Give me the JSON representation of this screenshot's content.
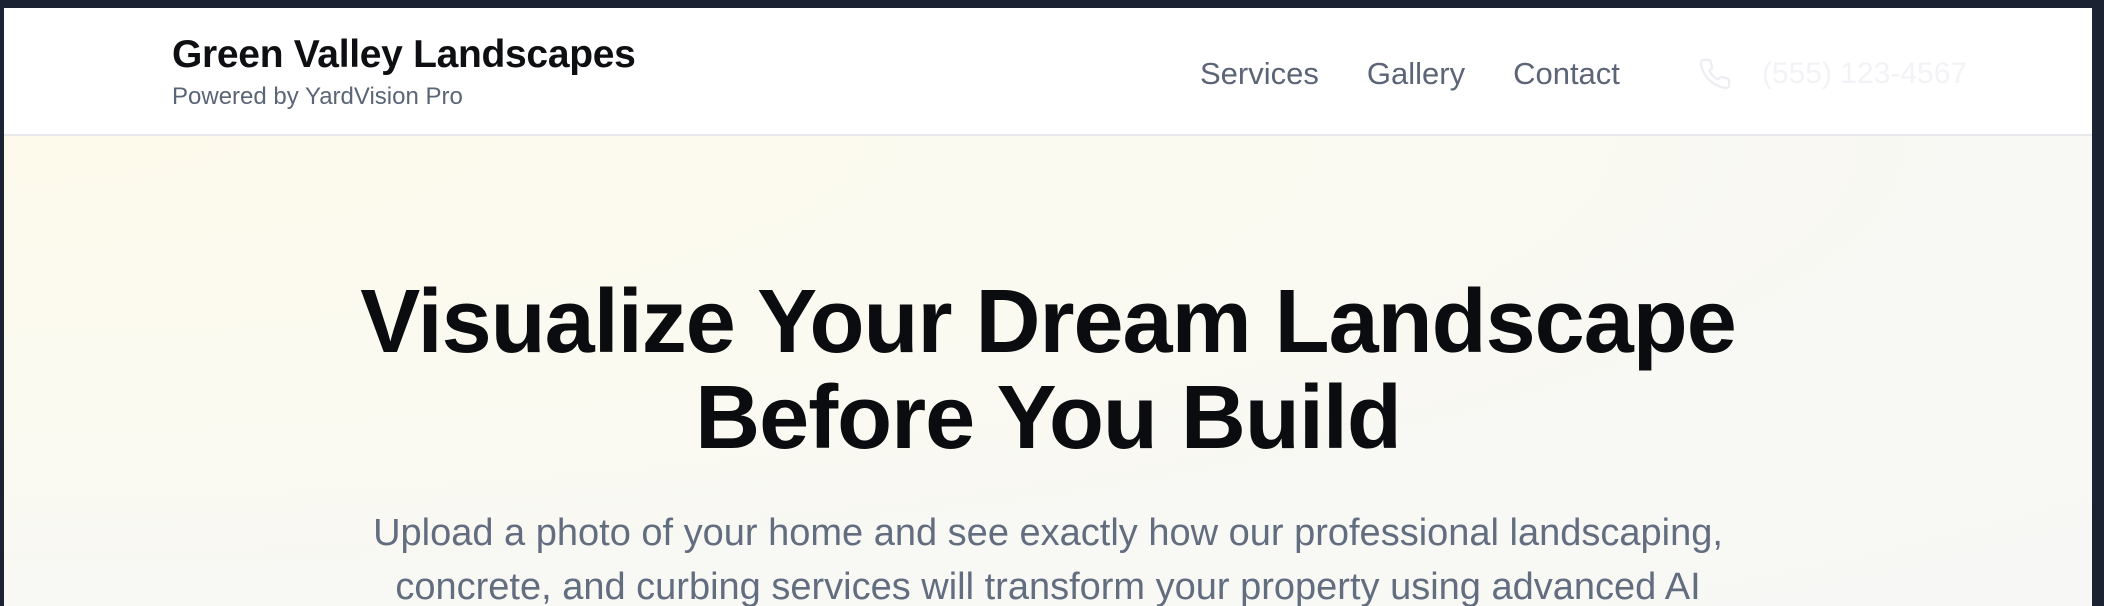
{
  "header": {
    "brand_name": "Green Valley Landscapes",
    "brand_tagline": "Powered by YardVision Pro",
    "nav": [
      {
        "label": "Services"
      },
      {
        "label": "Gallery"
      },
      {
        "label": "Contact"
      }
    ],
    "phone": {
      "icon": "phone-icon",
      "number": "(555) 123-4567"
    }
  },
  "hero": {
    "title_line1": "Visualize Your Dream Landscape",
    "title_line2": "Before You Build",
    "subtitle_line1": "Upload a photo of your home and see exactly how our professional landscaping,",
    "subtitle_line2": "concrete, and curbing services will transform your property using advanced AI"
  },
  "colors": {
    "page_frame": "#1b2232",
    "text_dark": "#0b0c0f",
    "nav_text": "#5b6577",
    "hero_bg": "#fbfaf0"
  }
}
